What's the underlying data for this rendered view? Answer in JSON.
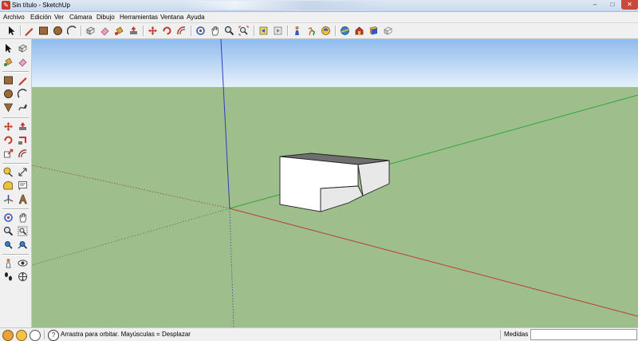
{
  "window": {
    "title": "Sin título - SketchUp",
    "minimize": "–",
    "maximize": "□",
    "close": "✕"
  },
  "menu": [
    "Archivo",
    "Edición",
    "Ver",
    "Cámara",
    "Dibujo",
    "Herramientas",
    "Ventana",
    "Ayuda"
  ],
  "toolbar_icons": [
    "select-icon",
    "pencil-line-icon",
    "rectangle-icon",
    "circle-icon",
    "arc-icon",
    "make-component-icon",
    "eraser-icon",
    "paint-bucket-icon",
    "push-pull-icon",
    "move-icon",
    "rotate-icon",
    "offset-icon",
    "orbit-icon",
    "pan-icon",
    "zoom-icon",
    "zoom-extents-icon",
    "previous-view-icon",
    "next-view-icon",
    "position-camera-icon",
    "walk-icon",
    "look-around-icon",
    "section-plane-icon",
    "3d-warehouse-icon",
    "component-library-icon"
  ],
  "colors": {
    "sky_top": "#8fbbed",
    "sky_bottom": "#e6f0fb",
    "ground": "#9ebf8c",
    "axis_red": "#c0392b",
    "axis_green": "#2ea43a",
    "axis_blue": "#2b3fbf",
    "box_face": "#ffffff",
    "box_top": "#6f6f6f"
  },
  "status": {
    "hint": "Arrastra para orbitar. Mayúsculas = Desplazar",
    "measure_label": "Medidas",
    "measure_value": ""
  }
}
